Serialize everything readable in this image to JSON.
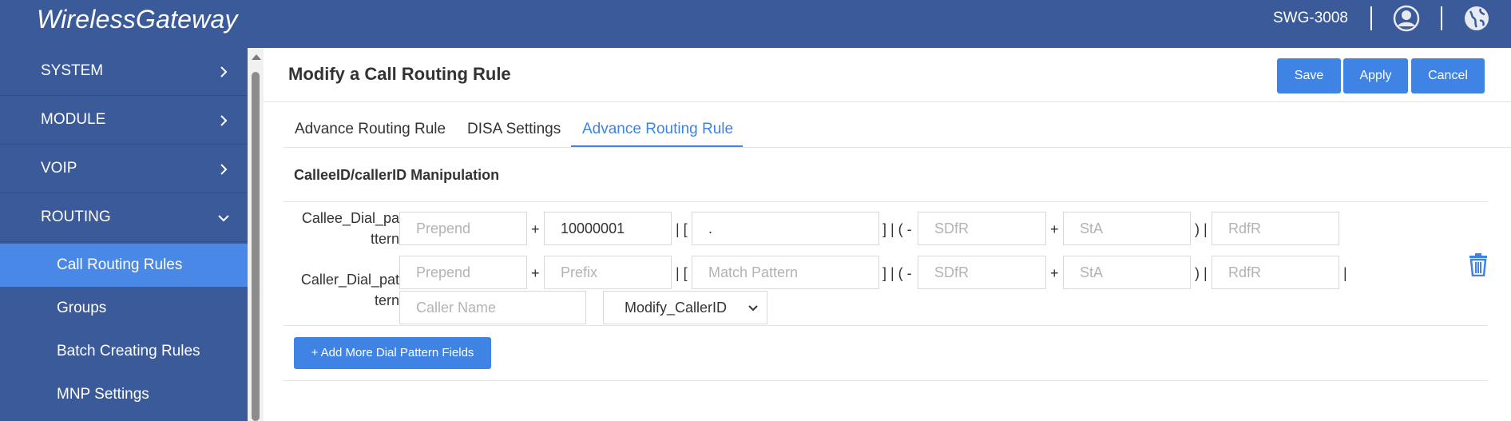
{
  "header": {
    "brand": "WirelessGateway",
    "model": "SWG-3008",
    "icons": [
      "user-icon",
      "globe-icon"
    ]
  },
  "sidebar": {
    "items": [
      {
        "label": "SYSTEM",
        "icon": "chevron-right-icon"
      },
      {
        "label": "MODULE",
        "icon": "chevron-right-icon"
      },
      {
        "label": "VOIP",
        "icon": "chevron-right-icon"
      },
      {
        "label": "ROUTING",
        "icon": "chevron-down-icon"
      }
    ],
    "subitems": [
      {
        "label": "Call Routing Rules",
        "active": true
      },
      {
        "label": "Groups"
      },
      {
        "label": "Batch Creating Rules"
      },
      {
        "label": "MNP Settings"
      }
    ]
  },
  "main": {
    "title": "Modify a Call Routing Rule",
    "buttons": {
      "save": "Save",
      "apply": "Apply",
      "cancel": "Cancel"
    },
    "tabs": [
      {
        "label": "Advance Routing Rule"
      },
      {
        "label": "DISA Settings"
      },
      {
        "label": "Advance Routing Rule",
        "active": true
      }
    ],
    "section_title": "CalleeID/callerID Manipulation",
    "callee": {
      "label_line1": "Callee_Dial_pa",
      "label_line2": "ttern",
      "prepend_placeholder": "Prepend",
      "prefix_value": "10000001",
      "match_value": ".",
      "sdfr_placeholder": "SDfR",
      "sta_placeholder": "StA",
      "rdfr_placeholder": "RdfR"
    },
    "caller": {
      "label_line1": "Caller_Dial_pat",
      "label_line2": "tern",
      "prepend_placeholder": "Prepend",
      "prefix_placeholder": "Prefix",
      "match_placeholder": "Match Pattern",
      "sdfr_placeholder": "SDfR",
      "sta_placeholder": "StA",
      "rdfr_placeholder": "RdfR",
      "name_placeholder": "Caller Name",
      "modify_select": "Modify_CallerID"
    },
    "symbols": {
      "plus": "+",
      "open": "| [",
      "mid": "] | ( -",
      "close": ") |",
      "bar": "|"
    },
    "add_button": "+ Add More Dial Pattern Fields"
  },
  "colors": {
    "header_bg": "#3a5a9a",
    "sidebar_bg": "#3a5a9a",
    "active_item": "#4a88e8",
    "primary": "#3f84e5"
  }
}
